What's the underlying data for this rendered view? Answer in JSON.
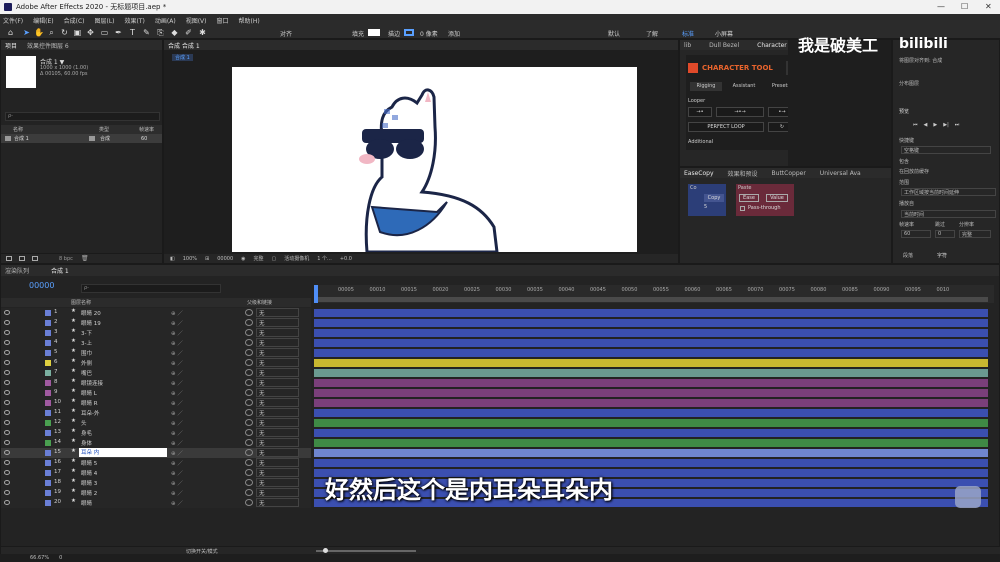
{
  "window": {
    "title": "Adobe After Effects 2020 - 无标题项目.aep *"
  },
  "menu": [
    "文件(F)",
    "编辑(E)",
    "合成(C)",
    "图层(L)",
    "效果(T)",
    "动画(A)",
    "视图(V)",
    "窗口",
    "帮助(H)"
  ],
  "toolbar": {
    "align": "对齐",
    "fill": "填充",
    "stroke": "描边",
    "px": "0 像素",
    "add": "添加",
    "workspaces": [
      "默认",
      "了解",
      "标准",
      "小屏幕"
    ]
  },
  "project": {
    "tabs": [
      "项目",
      "效果控件图层 6"
    ],
    "comp_name": "合成 1 ▼",
    "comp_info1": "1000 x 1000 (1.00)",
    "comp_info2": "Δ 00105, 60.00 fps",
    "col_name": "名称",
    "col_type": "类型",
    "col_fps": "帧速率",
    "item_name": "合成 1",
    "item_type": "合成",
    "item_fps": "60",
    "bpc": "8 bpc"
  },
  "composition": {
    "tab": "合成 合成 1",
    "sub_tab": "合成 1",
    "zoom": "100%",
    "timecode": "00000",
    "quality": "完整",
    "camera": "活动摄像机",
    "views": "1 个...",
    "offset": "+0.0"
  },
  "character_tool": {
    "tabs": [
      "lib",
      "Dull Bezel",
      "Character Tool"
    ],
    "title": "CHARACTER TOOL",
    "help": "?",
    "subtabs": [
      "Rigging",
      "Assistant",
      "Presets"
    ],
    "looper": "Looper",
    "perfect_loop": "PERFECT LOOP",
    "additional": "Additional"
  },
  "easecopy": {
    "tabs": [
      "EaseCopy",
      "效果和预设",
      "ButtCopper",
      "Universal Ava"
    ],
    "co": "Co",
    "copy": "Copy",
    "num": "5",
    "paste": "Paste",
    "ease": "Ease",
    "value": "Value",
    "pass": "Pass-through"
  },
  "watermark": "我是破美工",
  "brand": "bilibili",
  "right_panel": {
    "align_in": "将图层对齐到: 合成",
    "distribute": "分布图层",
    "preview": "预览",
    "shortcut": "快捷键",
    "shortcut_val": "空格键",
    "include": "包含",
    "cache": "在回放前缓存",
    "range": "范围",
    "range_val": "工作区域按当前时间延伸",
    "play_from": "播放自",
    "play_from_val": "当前时间",
    "fps": "帧速率",
    "skip": "跳过",
    "res": "分辨率",
    "fps_val": "60",
    "skip_val": "0",
    "res_val": "完整",
    "tabs": [
      "段落",
      "字符"
    ]
  },
  "timeline": {
    "tabs": [
      "渲染队列",
      "合成 1"
    ],
    "timecode": "00000",
    "search_placeholder": "ρ-",
    "col_name": "图层名称",
    "col_parent": "父级和链接",
    "ticks": [
      "00005",
      "00010",
      "00015",
      "00020",
      "00025",
      "00030",
      "00035",
      "00040",
      "00045",
      "00050",
      "00055",
      "00060",
      "00065",
      "00070",
      "00075",
      "00080",
      "00085",
      "00090",
      "00095",
      "0010"
    ],
    "footer_toggle": "切换开关/模式"
  },
  "layers": [
    {
      "num": "1",
      "name": "眼睛 20",
      "color": "#6a7fd6",
      "track": "#3b4fb0"
    },
    {
      "num": "2",
      "name": "眼睛 19",
      "color": "#6a7fd6",
      "track": "#3b4fb0"
    },
    {
      "num": "3",
      "name": "3-下",
      "color": "#6a7fd6",
      "track": "#3b4fb0"
    },
    {
      "num": "4",
      "name": "3-上",
      "color": "#6a7fd6",
      "track": "#3b4fb0"
    },
    {
      "num": "5",
      "name": "围巾",
      "color": "#6a7fd6",
      "track": "#3b4fb0"
    },
    {
      "num": "6",
      "name": "外侧",
      "color": "#e0d040",
      "track": "#c8b830"
    },
    {
      "num": "7",
      "name": "嘴巴",
      "color": "#7ab0a0",
      "track": "#6a9a90"
    },
    {
      "num": "8",
      "name": "眼镜连接",
      "color": "#a05aa0",
      "track": "#7a3f7a"
    },
    {
      "num": "9",
      "name": "眼睛 L",
      "color": "#a05aa0",
      "track": "#7a3f7a"
    },
    {
      "num": "10",
      "name": "眼睛 R",
      "color": "#a05aa0",
      "track": "#7a3f7a"
    },
    {
      "num": "11",
      "name": "耳朵-外",
      "color": "#6a7fd6",
      "track": "#3b4fb0"
    },
    {
      "num": "12",
      "name": "头",
      "color": "#4aa050",
      "track": "#3f8a45"
    },
    {
      "num": "13",
      "name": "身毛",
      "color": "#6a7fd6",
      "track": "#3b4fb0"
    },
    {
      "num": "14",
      "name": "身体",
      "color": "#4aa050",
      "track": "#3f8a45"
    },
    {
      "num": "15",
      "name": "耳朵 内",
      "color": "#6a7fd6",
      "track": "#6f86d0"
    },
    {
      "num": "16",
      "name": "眼睛 5",
      "color": "#6a7fd6",
      "track": "#3b4fb0"
    },
    {
      "num": "17",
      "name": "眼睛 4",
      "color": "#6a7fd6",
      "track": "#3b4fb0"
    },
    {
      "num": "18",
      "name": "眼睛 3",
      "color": "#6a7fd6",
      "track": "#3b4fb0"
    },
    {
      "num": "19",
      "name": "眼睛 2",
      "color": "#6a7fd6",
      "track": "#3b4fb0"
    },
    {
      "num": "20",
      "name": "眼睛",
      "color": "#6a7fd6",
      "track": "#3b4fb0"
    }
  ],
  "parent_none": "无",
  "subtitle": "好然后这个是内耳朵耳朵内",
  "status": {
    "zoom": "66.67%",
    "frame": "0"
  }
}
